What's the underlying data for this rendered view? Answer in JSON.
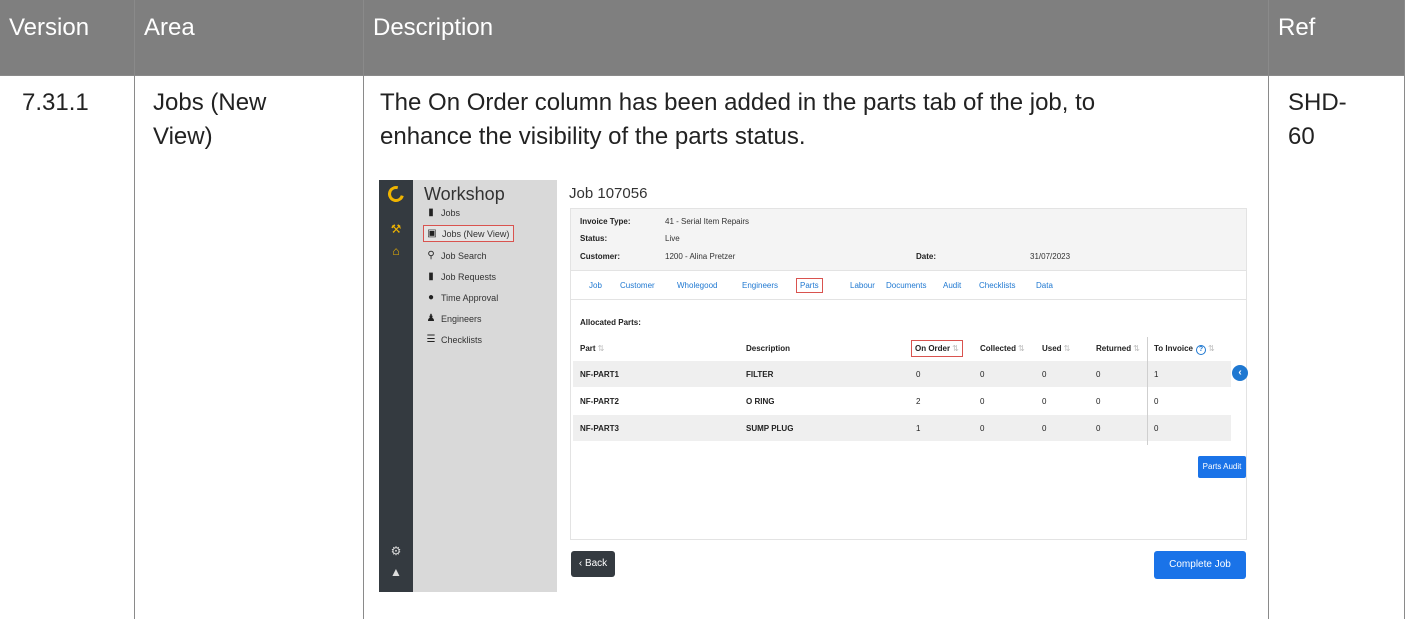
{
  "table": {
    "headers": {
      "version": "Version",
      "area": "Area",
      "description": "Description",
      "ref": "Ref"
    },
    "row": {
      "version": "7.31.1",
      "area_line1": "Jobs (New",
      "area_line2": "View)",
      "description_line1": "The On Order column has been added in the parts tab of the job, to",
      "description_line2": "enhance the visibility of the parts status.",
      "ref_line1": "SHD-",
      "ref_line2": "60"
    }
  },
  "screenshot": {
    "app_title": "Workshop",
    "menu": [
      {
        "icon": "clipboard-icon",
        "glyph": "▮",
        "label": "Jobs"
      },
      {
        "icon": "kanban-icon",
        "glyph": "▣",
        "label": "Jobs (New View)",
        "highlighted": true
      },
      {
        "icon": "search-icon",
        "glyph": "⚲",
        "label": "Job Search"
      },
      {
        "icon": "clipboard-check-icon",
        "glyph": "▮",
        "label": "Job Requests"
      },
      {
        "icon": "clock-icon",
        "glyph": "●",
        "label": "Time Approval"
      },
      {
        "icon": "users-icon",
        "glyph": "♟",
        "label": "Engineers"
      },
      {
        "icon": "checklist-icon",
        "glyph": "☰",
        "label": "Checklists"
      }
    ],
    "job_title": "Job 107056",
    "info": {
      "invoice_type_label": "Invoice Type:",
      "invoice_type_value": "41 - Serial Item Repairs",
      "status_label": "Status:",
      "status_value": "Live",
      "customer_label": "Customer:",
      "customer_value": "1200 - Alina Pretzer",
      "date_label": "Date:",
      "date_value": "31/07/2023"
    },
    "tabs": [
      "Job",
      "Customer",
      "Wholegood",
      "Engineers",
      "Parts",
      "Labour",
      "Documents",
      "Audit",
      "Checklists",
      "Data"
    ],
    "active_tab": "Parts",
    "allocated_label": "Allocated Parts:",
    "columns": [
      "Part",
      "Description",
      "On Order",
      "Collected",
      "Used",
      "Returned",
      "To Invoice"
    ],
    "rows": [
      {
        "part": "NF-PART1",
        "description": "FILTER",
        "on_order": "0",
        "collected": "0",
        "used": "0",
        "returned": "0",
        "to_invoice": "1"
      },
      {
        "part": "NF-PART2",
        "description": "O RING",
        "on_order": "2",
        "collected": "0",
        "used": "0",
        "returned": "0",
        "to_invoice": "0"
      },
      {
        "part": "NF-PART3",
        "description": "SUMP PLUG",
        "on_order": "1",
        "collected": "0",
        "used": "0",
        "returned": "0",
        "to_invoice": "0"
      }
    ],
    "parts_audit_label": "Parts Audit",
    "back_label": "Back",
    "complete_label": "Complete Job",
    "colors": {
      "accent_blue": "#1a73e8",
      "rail_dark": "#343a40",
      "logo_yellow": "#f0b400",
      "highlight_red": "#d9534f"
    }
  }
}
